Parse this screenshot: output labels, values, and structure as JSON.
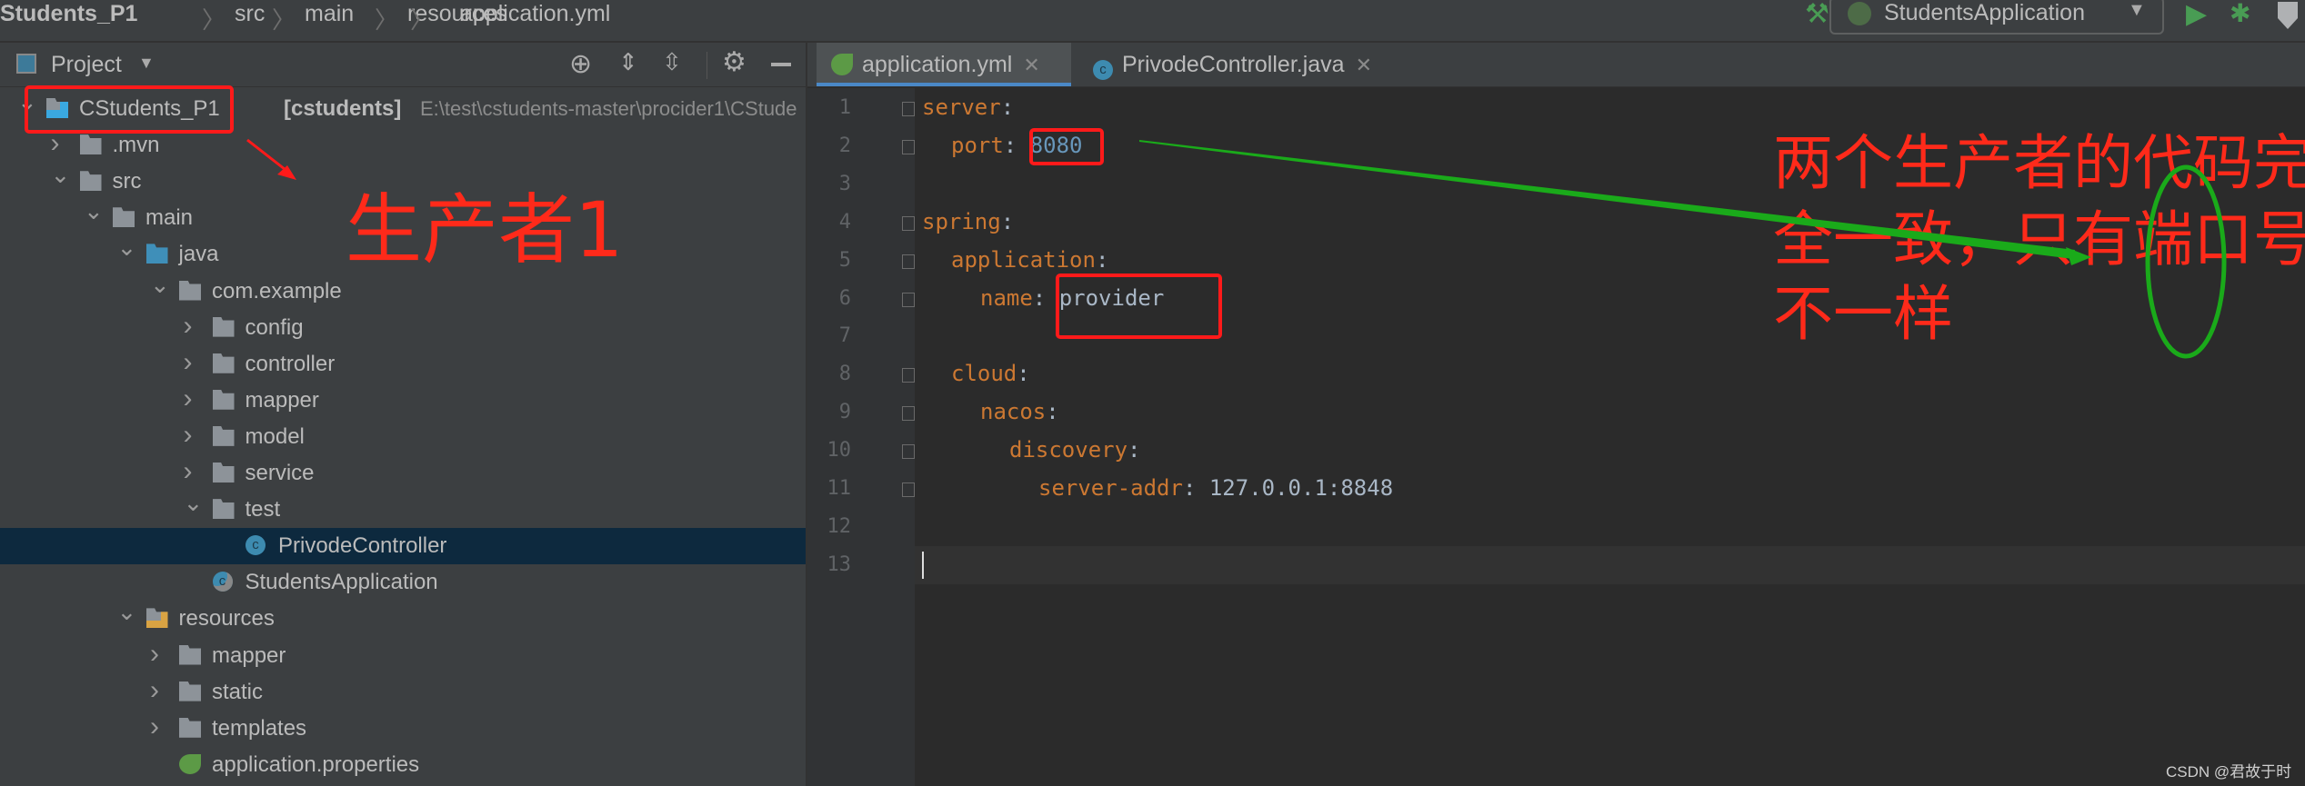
{
  "navbar": {
    "breadcrumbs": [
      "Students_P1",
      "src",
      "main",
      "resources",
      "application.yml"
    ],
    "run_config": "StudentsApplication",
    "icons": [
      "hammer-icon",
      "spring-boot-icon",
      "run-icon",
      "debug-icon",
      "coverage-icon"
    ]
  },
  "project_panel": {
    "title": "Project",
    "tools": [
      "locate-icon",
      "expand-all-icon",
      "collapse-all-icon",
      "gear-icon",
      "minimize-icon"
    ],
    "tree": [
      {
        "label": "CStudents_P1",
        "module": "[cstudents]",
        "path": "E:\\test\\cstudents-master\\procider1\\CStude",
        "level": 0,
        "arrow": "open",
        "icon": "module-folder"
      },
      {
        "label": ".mvn",
        "level": 1,
        "arrow": "closed",
        "icon": "folder"
      },
      {
        "label": "src",
        "level": 1,
        "arrow": "open",
        "icon": "folder"
      },
      {
        "label": "main",
        "level": 2,
        "arrow": "open",
        "icon": "folder"
      },
      {
        "label": "java",
        "level": 3,
        "arrow": "open",
        "icon": "source-folder"
      },
      {
        "label": "com.example",
        "level": 4,
        "arrow": "open",
        "icon": "package"
      },
      {
        "label": "config",
        "level": 5,
        "arrow": "closed",
        "icon": "package"
      },
      {
        "label": "controller",
        "level": 5,
        "arrow": "closed",
        "icon": "package"
      },
      {
        "label": "mapper",
        "level": 5,
        "arrow": "closed",
        "icon": "package"
      },
      {
        "label": "model",
        "level": 5,
        "arrow": "closed",
        "icon": "package"
      },
      {
        "label": "service",
        "level": 5,
        "arrow": "closed",
        "icon": "package"
      },
      {
        "label": "test",
        "level": 5,
        "arrow": "open",
        "icon": "package"
      },
      {
        "label": "PrivodeController",
        "level": 6,
        "arrow": "none",
        "icon": "class",
        "selected": true
      },
      {
        "label": "StudentsApplication",
        "level": 5,
        "arrow": "none",
        "icon": "spring-class"
      },
      {
        "label": "resources",
        "level": 3,
        "arrow": "open",
        "icon": "resources-folder"
      },
      {
        "label": "mapper",
        "level": 4,
        "arrow": "closed",
        "icon": "folder"
      },
      {
        "label": "static",
        "level": 4,
        "arrow": "closed",
        "icon": "folder"
      },
      {
        "label": "templates",
        "level": 4,
        "arrow": "closed",
        "icon": "folder"
      },
      {
        "label": "application.properties",
        "level": 4,
        "arrow": "none",
        "icon": "spring-file"
      }
    ]
  },
  "editor": {
    "tabs": [
      {
        "label": "application.yml",
        "active": true,
        "icon": "spring-yaml-icon"
      },
      {
        "label": "PrivodeController.java",
        "active": false,
        "icon": "class-icon"
      }
    ],
    "lines": [
      {
        "num": "1",
        "key": "server",
        "value": "",
        "indent": 0
      },
      {
        "num": "2",
        "key": "port",
        "value": "8080",
        "indent": 1,
        "number": true
      },
      {
        "num": "3",
        "key": "",
        "value": "",
        "indent": 0
      },
      {
        "num": "4",
        "key": "spring",
        "value": "",
        "indent": 0
      },
      {
        "num": "5",
        "key": "application",
        "value": "",
        "indent": 1
      },
      {
        "num": "6",
        "key": "name",
        "value": "provider",
        "indent": 2
      },
      {
        "num": "7",
        "key": "",
        "value": "",
        "indent": 0
      },
      {
        "num": "8",
        "key": "cloud",
        "value": "",
        "indent": 1
      },
      {
        "num": "9",
        "key": "nacos",
        "value": "",
        "indent": 2
      },
      {
        "num": "10",
        "key": "discovery",
        "value": "",
        "indent": 3
      },
      {
        "num": "11",
        "key": "server-addr",
        "value": "127.0.0.1:8848",
        "indent": 4
      },
      {
        "num": "12",
        "key": "",
        "value": "",
        "indent": 0
      },
      {
        "num": "13",
        "key": "",
        "value": "",
        "indent": 0,
        "current": true
      }
    ]
  },
  "annotations": {
    "producer_label": "生产者1",
    "note_lines": [
      "两个生产者的代码完",
      "全一致，只有端口号",
      "不一样"
    ],
    "colors": {
      "red": "#ff1a1a",
      "green": "#1aaa1a"
    }
  },
  "watermark": "CSDN @君故于时",
  "colors": {
    "editor_bg": "#2b2b2b",
    "panel_bg": "#3c3f41",
    "selection": "#0d293e",
    "yaml_key": "#cc7832",
    "yaml_number": "#6897bb"
  }
}
